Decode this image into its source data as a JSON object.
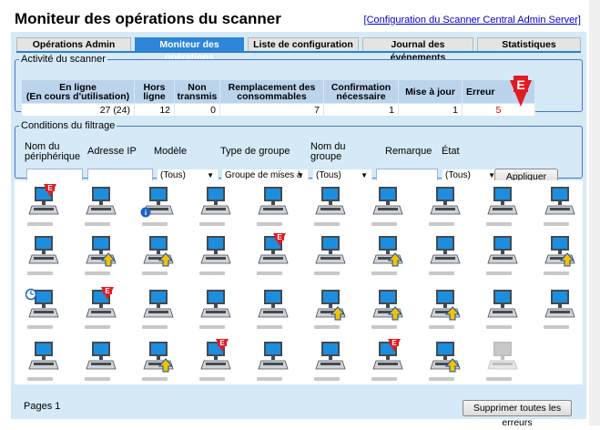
{
  "header": {
    "title": "Moniteur des opérations du scanner",
    "config_link": "[Configuration du Scanner Central Admin Server]"
  },
  "tabs": [
    {
      "label": "Opérations Admin"
    },
    {
      "label": "Moniteur des opérations",
      "active": true
    },
    {
      "label": "Liste de configuration"
    },
    {
      "label": "Journal des événements"
    },
    {
      "label": "Statistiques"
    }
  ],
  "activity": {
    "legend": "Activité du scanner",
    "headers": {
      "online_1": "En ligne",
      "online_2": "(En cours d'utilisation)",
      "offline_1": "Hors",
      "offline_2": "ligne",
      "not_sent_1": "Non",
      "not_sent_2": "transmis",
      "consumables_1": "Remplacement des",
      "consumables_2": "consommables",
      "confirm_1": "Confirmation",
      "confirm_2": "nécessaire",
      "update": "Mise à jour",
      "error": "Erreur"
    },
    "values": {
      "online": "27 (24)",
      "offline": "12",
      "not_sent": "0",
      "consumables": "7",
      "confirm": "1",
      "update": "1",
      "error": "5"
    },
    "error_color": "#e00000"
  },
  "filter": {
    "legend": "Conditions du filtrage",
    "labels": {
      "device_name_1": "Nom du",
      "device_name_2": "périphérique",
      "ip": "Adresse IP",
      "model": "Modèle",
      "group_type": "Type de groupe",
      "group_name_1": "Nom du",
      "group_name_2": "groupe",
      "remark": "Remarque",
      "state": "État"
    },
    "model_value": "(Tous)",
    "group_type_value": "Groupe de mises à",
    "group_name_value": "(Tous)",
    "state_value": "(Tous)",
    "apply_label": "Appliquer"
  },
  "footer": {
    "pages": "Pages 1",
    "clear_errors": "Supprimer toutes les erreurs"
  },
  "scanners": [
    [
      "error",
      "normal",
      "info",
      "normal",
      "normal",
      "normal",
      "normal",
      "normal",
      "normal",
      "normal"
    ],
    [
      "normal",
      "update",
      "update",
      "normal",
      "error",
      "normal",
      "update",
      "normal",
      "normal",
      "update"
    ],
    [
      "clock",
      "error",
      "normal",
      "normal",
      "normal",
      "update",
      "update",
      "update",
      "normal",
      "normal"
    ],
    [
      "normal",
      "normal",
      "update",
      "error",
      "normal",
      "normal",
      "error",
      "update",
      "disabled"
    ]
  ],
  "colors": {
    "accent": "#2d86d8",
    "panel_bg": "#d6e9f6",
    "error_red": "#e21b22",
    "update_yellow": "#f2c200"
  }
}
